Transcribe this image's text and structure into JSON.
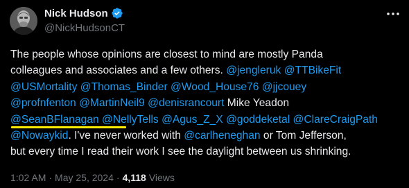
{
  "author": {
    "display_name": "Nick Hudson",
    "handle": "@NickHudsonCT",
    "verified": true,
    "avatar_icon": "profile-photo"
  },
  "tweet": {
    "lines": [
      [
        {
          "t": "The people whose opinions are closest to mind are mostly Panda",
          "m": false
        }
      ],
      [
        {
          "t": "colleagues and associates and a few others. ",
          "m": false
        },
        {
          "t": "@jengleruk",
          "m": true
        },
        {
          "t": " ",
          "m": false
        },
        {
          "t": "@TTBikeFit",
          "m": true
        }
      ],
      [
        {
          "t": "@USMortality",
          "m": true
        },
        {
          "t": " ",
          "m": false
        },
        {
          "t": "@Thomas_Binder",
          "m": true
        },
        {
          "t": " ",
          "m": false
        },
        {
          "t": "@Wood_House76",
          "m": true
        },
        {
          "t": " ",
          "m": false
        },
        {
          "t": "@jjcouey",
          "m": true
        }
      ],
      [
        {
          "t": "@profnfenton",
          "m": true
        },
        {
          "t": " ",
          "m": false
        },
        {
          "t": "@MartinNeil9",
          "m": true
        },
        {
          "t": " ",
          "m": false
        },
        {
          "t": "@denisrancourt",
          "m": true
        },
        {
          "t": " Mike Yeadon",
          "m": false
        }
      ],
      [
        {
          "t": "@SeanBFlanagan",
          "m": true
        },
        {
          "t": " ",
          "m": false
        },
        {
          "t": "@NellyTells",
          "m": true
        },
        {
          "t": " ",
          "m": false
        },
        {
          "t": "@Agus_Z_X",
          "m": true
        },
        {
          "t": " ",
          "m": false
        },
        {
          "t": "@goddeketal",
          "m": true
        },
        {
          "t": " ",
          "m": false
        },
        {
          "t": "@ClareCraigPath",
          "m": true
        }
      ],
      [
        {
          "t": "@Nowaykid",
          "m": true
        },
        {
          "t": ". I've never worked with ",
          "m": false
        },
        {
          "t": "@carlheneghan",
          "m": true
        },
        {
          "t": " or Tom Jefferson,",
          "m": false
        }
      ],
      [
        {
          "t": "but every time I read their work I see the daylight between us shrinking.",
          "m": false
        }
      ]
    ]
  },
  "meta": {
    "time": "1:02 AM",
    "separator": "·",
    "date": "May 25, 2024",
    "views_count": "4,118",
    "views_label": "Views"
  },
  "colors": {
    "background": "#000000",
    "text": "#e7e9ea",
    "mention": "#1d9bf0",
    "secondary": "#71767b",
    "verified": "#1d9bf0",
    "highlight_underline": "#ffeb00"
  },
  "icons": {
    "verified": "verified-badge-icon",
    "more": "more-options-icon"
  }
}
